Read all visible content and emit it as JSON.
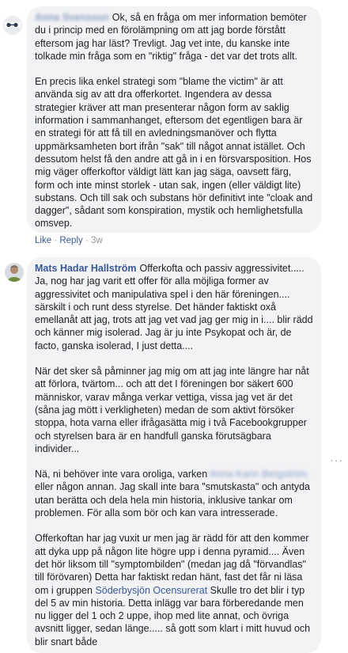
{
  "comment1": {
    "author": "Anna Svensson",
    "paragraphs": [
      "Ok, så en fråga om mer information bemöter du i princip med en förolämpning om att jag borde förstått eftersom jag har läst? Trevligt. Jag vet inte, du kanske inte tolkade min fråga som en \"riktig\" fråga - det var det trots allt.",
      "En precis lika enkel strategi som \"blame the victim\" är att använda sig av att dra offerkortet. Ingendera av dessa strategier kräver att man presenterar någon form av saklig information i sammanhanget, eftersom det egentligen bara är en strategi för att få till en avledningsmanöver och flytta uppmärksamheten bort ifrån \"sak\" till något annat istället. Och dessutom helst få den andre att gå in i en försvarsposition. Hos mig väger offerkoftor väldigt lätt kan jag säga, oavsett färg, form och inte minst storlek - utan sak, ingen (eller väldigt lite) substans. Och till sak och substans hör definitivt inte \"cloak and dagger\", sådant som konspiration, mystik och hemlighetsfulla omsvep."
    ],
    "actions": {
      "like": "Like",
      "sep1": "·",
      "reply": "Reply",
      "sep2": "·",
      "time": "3w"
    }
  },
  "comment2": {
    "author": "Mats Hadar Hallström",
    "p1": "Offerkofta och passiv aggressivitet..... Ja, nog har jag varit ett offer för alla möjliga former av aggressivitet och manipulativa spel i den här föreningen.... särskilt i och runt dess styrelse. Det händer faktiskt oxå emellanåt att jag, trots att jag vet vad jag ger mig in i.... blir rädd och känner mig isolerad. Jag är ju inte Psykopat och är, de facto, ganska isolerad, I just detta....",
    "p2": "När det sker så påminner jag mig om att jag inte längre har nåt att förlora, tvärtom... och att det I föreningen bor säkert 600 människor, varav många verkar vettiga, vissa jag vet är det (såna jag mött i verkligheten) medan de som aktivt försöker stoppa, hota varna eller ifrågasätta mig i två Facebookgrupper och styrelsen bara är en handfull ganska förutsägbara individer...",
    "p3_before": "Nä, ni behöver inte vara oroliga, varken ",
    "p3_tag": "Anna-Karin Bergström",
    "p3_after": " eller någon annan. Jag skall inte bara \"smutskasta\" och antyda utan berätta och dela hela min historia, inklusive tankar om problemen. För alla som bör och kan vara intresserade.",
    "p4_before": "Offerkoftan har jag vuxit ur men jag är rädd för att den kommer att dyka upp på någon lite högre upp i denna pyramid.... Även det hör liksom till \"symptombilden\" (medan jag då \"förvandlas\" till förövaren) Detta har faktiskt redan hänt, fast det får ni läsa om i gruppen ",
    "p4_link": "Söderbysjön Ocensurerat",
    "p4_after": " Skulle tro det blir i typ del 5 av min historia. Detta inlägg var bara förberedande men nu ligger del 1 och 2 uppe, ihop med lite annat, och övriga avsnitt ligger, sedan länge..... så gott som klart i mitt huvud och blir snart både",
    "more_dots": "···"
  },
  "colors": {
    "bubble": "#f2f3f5",
    "link": "#385898",
    "meta": "#90949c"
  }
}
